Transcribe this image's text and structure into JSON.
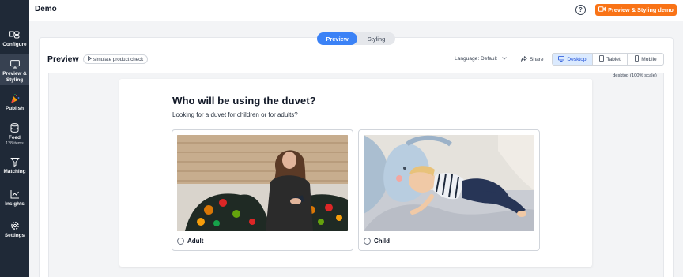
{
  "app": {
    "title": "Demo",
    "demo_button": "Preview & Styling demo"
  },
  "sidebar": {
    "items": [
      {
        "label": "Configure",
        "icon": "configure-icon"
      },
      {
        "label": "Preview & Styling",
        "line1": "Preview &",
        "line2": "Styling",
        "icon": "preview-icon",
        "active": true
      },
      {
        "label": "Publish",
        "icon": "publish-icon"
      },
      {
        "label": "Feed",
        "sub": "128 items",
        "icon": "database-icon"
      },
      {
        "label": "Matching",
        "icon": "funnel-icon"
      },
      {
        "label": "Insights",
        "icon": "chart-icon"
      },
      {
        "label": "Settings",
        "icon": "gear-icon"
      }
    ]
  },
  "tabs": {
    "preview": "Preview",
    "styling": "Styling",
    "active": "Preview"
  },
  "toolbar": {
    "title": "Preview",
    "simulate": "simulate product check",
    "language": "Language: Default",
    "share": "Share",
    "devices": {
      "desktop": "Desktop",
      "tablet": "Tablet",
      "mobile": "Mobile",
      "selected": "Desktop"
    },
    "scale": "desktop (100% scale)"
  },
  "question": {
    "title": "Who will be using the duvet?",
    "subtitle": "Looking for a duvet for children or for adults?",
    "options": [
      {
        "label": "Adult",
        "selected": false
      },
      {
        "label": "Child",
        "selected": false
      }
    ]
  },
  "colors": {
    "accent": "#3b82f6",
    "brand_orange": "#f97316",
    "sidebar": "#1f2937"
  }
}
